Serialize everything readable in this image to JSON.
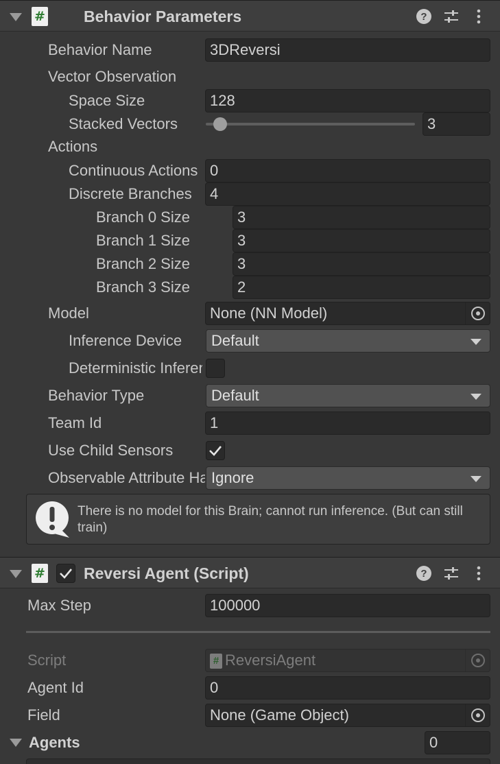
{
  "behavior_parameters": {
    "title": "Behavior Parameters",
    "behavior_name": {
      "label": "Behavior Name",
      "value": "3DReversi"
    },
    "vector_observation": {
      "label": "Vector Observation",
      "space_size": {
        "label": "Space Size",
        "value": "128"
      },
      "stacked_vectors": {
        "label": "Stacked Vectors",
        "value": "3",
        "slider_fraction": 0.04
      }
    },
    "actions": {
      "label": "Actions",
      "continuous": {
        "label": "Continuous Actions",
        "value": "0"
      },
      "discrete": {
        "label": "Discrete Branches",
        "value": "4"
      },
      "branches": [
        {
          "label": "Branch 0 Size",
          "value": "3"
        },
        {
          "label": "Branch 1 Size",
          "value": "3"
        },
        {
          "label": "Branch 2 Size",
          "value": "3"
        },
        {
          "label": "Branch 3 Size",
          "value": "2"
        }
      ]
    },
    "model": {
      "label": "Model",
      "value": "None (NN Model)",
      "inference_device": {
        "label": "Inference Device",
        "value": "Default"
      },
      "deterministic": {
        "label": "Deterministic Inference",
        "checked": false
      }
    },
    "behavior_type": {
      "label": "Behavior Type",
      "value": "Default"
    },
    "team_id": {
      "label": "Team Id",
      "value": "1"
    },
    "use_child_sensors": {
      "label": "Use Child Sensors",
      "checked": true
    },
    "observable_attribute": {
      "label": "Observable Attribute Handling",
      "value": "Ignore"
    },
    "help_message": "There is no model for this Brain; cannot run inference. (But can still train)"
  },
  "reversi_agent": {
    "title": "Reversi Agent (Script)",
    "enabled": true,
    "max_step": {
      "label": "Max Step",
      "value": "100000"
    },
    "script": {
      "label": "Script",
      "value": "ReversiAgent"
    },
    "agent_id": {
      "label": "Agent Id",
      "value": "0"
    },
    "field": {
      "label": "Field",
      "value": "None (Game Object)"
    },
    "agents": {
      "label": "Agents",
      "value": "0"
    }
  },
  "icons": {
    "script": "script-icon",
    "help": "help-icon",
    "presets": "presets-icon",
    "menu": "kebab-menu-icon",
    "foldout": "foldout-arrow-icon",
    "object_picker": "object-picker-icon",
    "warning": "info-icon"
  }
}
